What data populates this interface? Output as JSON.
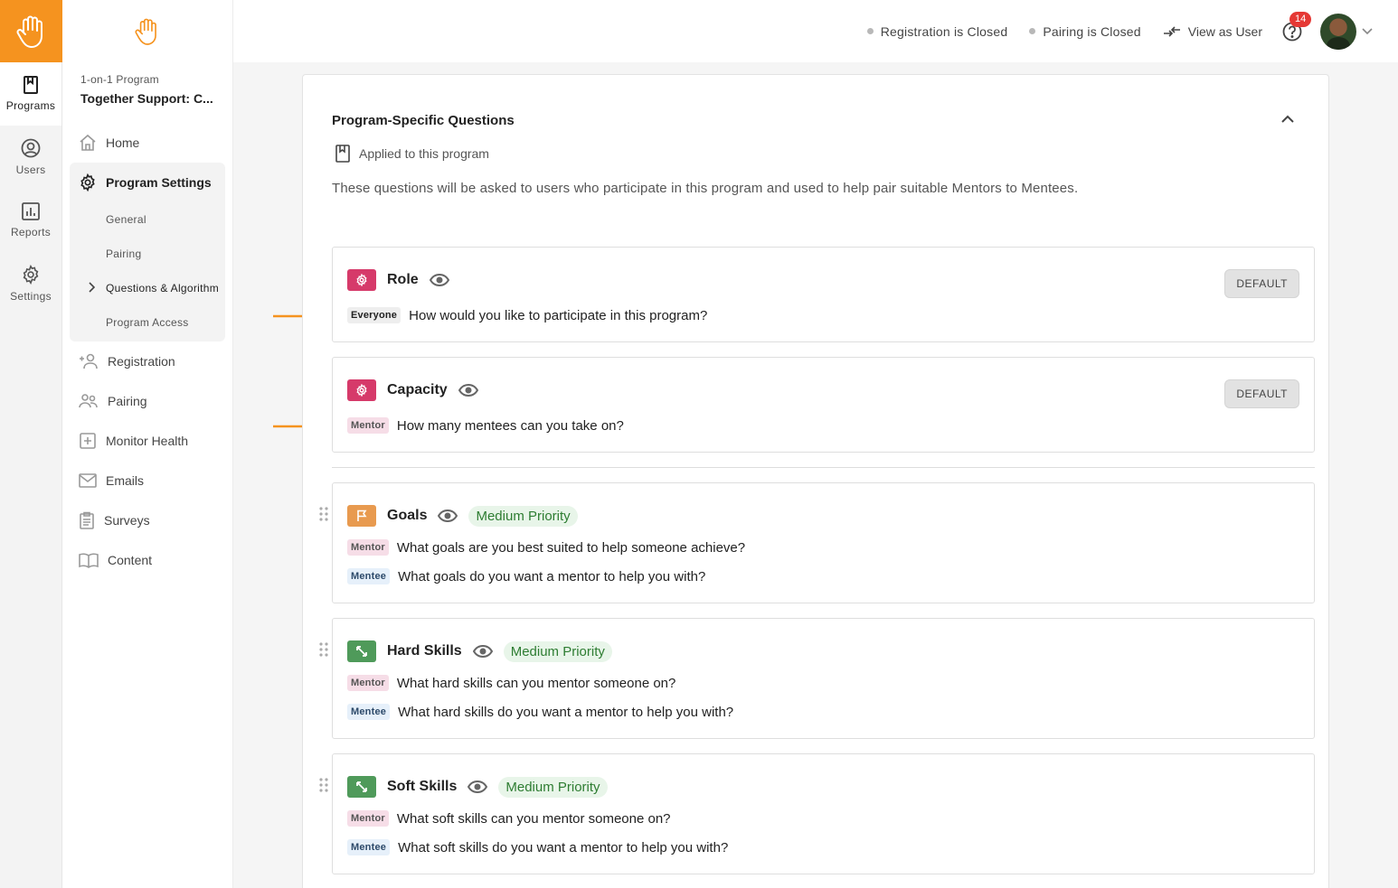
{
  "rail": {
    "items": [
      {
        "label": "Programs",
        "icon": "book-icon"
      },
      {
        "label": "Users",
        "icon": "user-circle-icon"
      },
      {
        "label": "Reports",
        "icon": "bar-chart-icon"
      },
      {
        "label": "Settings",
        "icon": "gear-icon"
      }
    ]
  },
  "sidebar": {
    "program_kind": "1-on-1 Program",
    "program_name": "Together Support: C...",
    "items": [
      {
        "label": "Home"
      },
      {
        "label": "Program Settings"
      },
      {
        "label": "Registration"
      },
      {
        "label": "Pairing"
      },
      {
        "label": "Monitor Health"
      },
      {
        "label": "Emails"
      },
      {
        "label": "Surveys"
      },
      {
        "label": "Content"
      }
    ],
    "settings_sub": [
      {
        "label": "General"
      },
      {
        "label": "Pairing"
      },
      {
        "label": "Questions & Algorithm"
      },
      {
        "label": "Program Access"
      }
    ]
  },
  "topbar": {
    "registration_status": "Registration is Closed",
    "pairing_status": "Pairing is Closed",
    "view_as_user": "View as User",
    "notification_count": "14"
  },
  "section": {
    "title": "Program-Specific Questions",
    "applied": "Applied to this program",
    "description": "These questions will be asked to users who participate in this program and used to help pair suitable Mentors to Mentees."
  },
  "questions": {
    "role": {
      "name": "Role",
      "badge": "DEFAULT",
      "rows": [
        {
          "tag": "Everyone",
          "text": "How would you like to participate in this program?"
        }
      ]
    },
    "capacity": {
      "name": "Capacity",
      "badge": "DEFAULT",
      "rows": [
        {
          "tag": "Mentor",
          "text": "How many mentees can you take on?"
        }
      ]
    },
    "goals": {
      "name": "Goals",
      "priority": "Medium Priority",
      "rows": [
        {
          "tag": "Mentor",
          "text": "What goals are you best suited to help someone achieve?"
        },
        {
          "tag": "Mentee",
          "text": "What goals do you want a mentor to help you with?"
        }
      ]
    },
    "hard_skills": {
      "name": "Hard Skills",
      "priority": "Medium Priority",
      "rows": [
        {
          "tag": "Mentor",
          "text": "What hard skills can you mentor someone on?"
        },
        {
          "tag": "Mentee",
          "text": "What hard skills do you want a mentor to help you with?"
        }
      ]
    },
    "soft_skills": {
      "name": "Soft Skills",
      "priority": "Medium Priority",
      "rows": [
        {
          "tag": "Mentor",
          "text": "What soft skills can you mentor someone on?"
        },
        {
          "tag": "Mentee",
          "text": "What soft skills do you want a mentor to help you with?"
        }
      ]
    }
  },
  "colors": {
    "brand": "#f5931f",
    "default_icon": "#d63a6a",
    "goals_icon": "#e89a4f",
    "skills_icon": "#4f9a5a",
    "annotation_arrow": "#f5931f"
  }
}
